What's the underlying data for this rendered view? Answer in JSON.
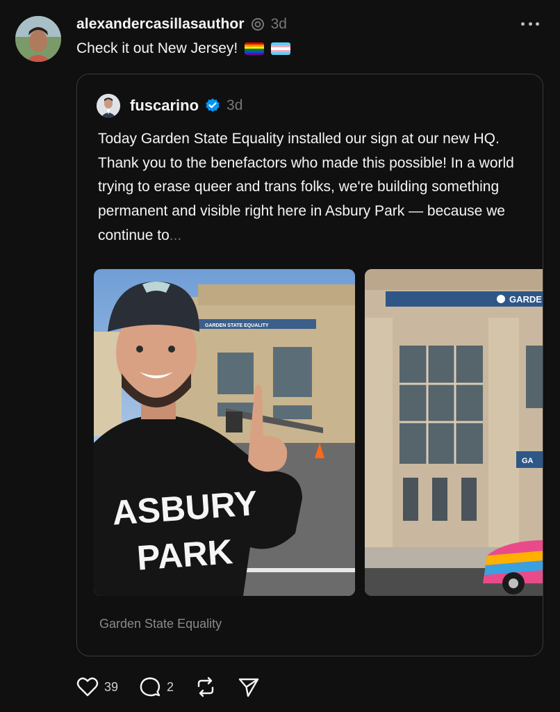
{
  "post": {
    "author": "alexandercasillasauthor",
    "time": "3d",
    "text": "Check it out New Jersey!",
    "emojis": [
      "rainbow-flag",
      "transgender-flag"
    ],
    "more_icon": "more-horizontal-icon"
  },
  "quoted": {
    "author": "fuscarino",
    "verified": true,
    "time": "3d",
    "body": "Today Garden State Equality installed our sign at our new HQ. Thank you to the benefactors who made this possible! In a world trying to erase queer and trans folks, we're building something permanent and visible right here in Asbury Park — because we continue to",
    "ellipsis": "...",
    "photo1": {
      "shirt_line1": "ASBURY",
      "shirt_line2": "PARK",
      "sign_text": "GARDEN STATE EQUALITY"
    },
    "photo2": {
      "sign_text": "GARDE",
      "small_sign_text": "GA"
    },
    "caption": "Garden State Equality"
  },
  "actions": {
    "likes": "39",
    "replies": "2",
    "icons": [
      "heart-icon",
      "comment-icon",
      "repost-icon",
      "share-icon"
    ]
  },
  "colors": {
    "background": "#101010",
    "text": "#f3f5f7",
    "muted": "#777777",
    "border": "#3a3a3a",
    "verified": "#0095f6"
  }
}
